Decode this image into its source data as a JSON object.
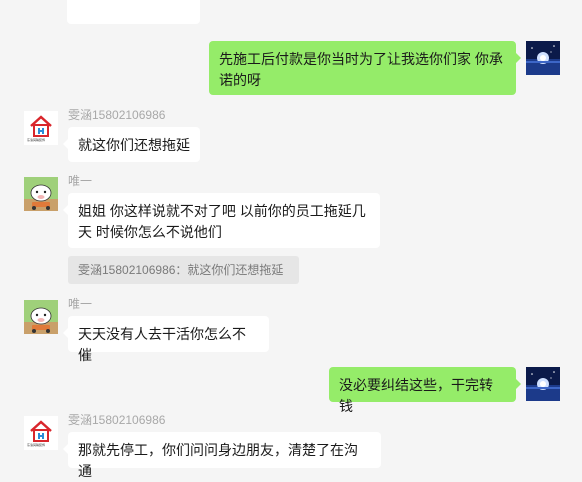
{
  "messages": [
    {
      "sender": "",
      "text": "先施工后付款是你当时为了让我选你们家  你承诺的呀"
    },
    {
      "sender": "雯涵15802106986",
      "text": "就这你们还想拖延"
    },
    {
      "sender": "唯一",
      "text": "姐姐 你这样说就不对了吧  以前你的员工拖延几天 时候你怎么不说他们",
      "quote": "雯涵15802106986：就这你们还想拖延"
    },
    {
      "sender": "唯一",
      "text": "天天没有人去干活你怎么不催"
    },
    {
      "sender": "",
      "text": "没必要纠结这些，干完转钱"
    },
    {
      "sender": "雯涵15802106986",
      "text": "那就先停工，你们问问身边朋友，清楚了在沟通"
    }
  ],
  "avatars": {
    "house_caption": "东渝润翰装饰"
  },
  "colors": {
    "background": "#f5f5f5",
    "bubble_out": "#95ec69",
    "bubble_in": "#ffffff",
    "sender_text": "#a8a8a8"
  }
}
